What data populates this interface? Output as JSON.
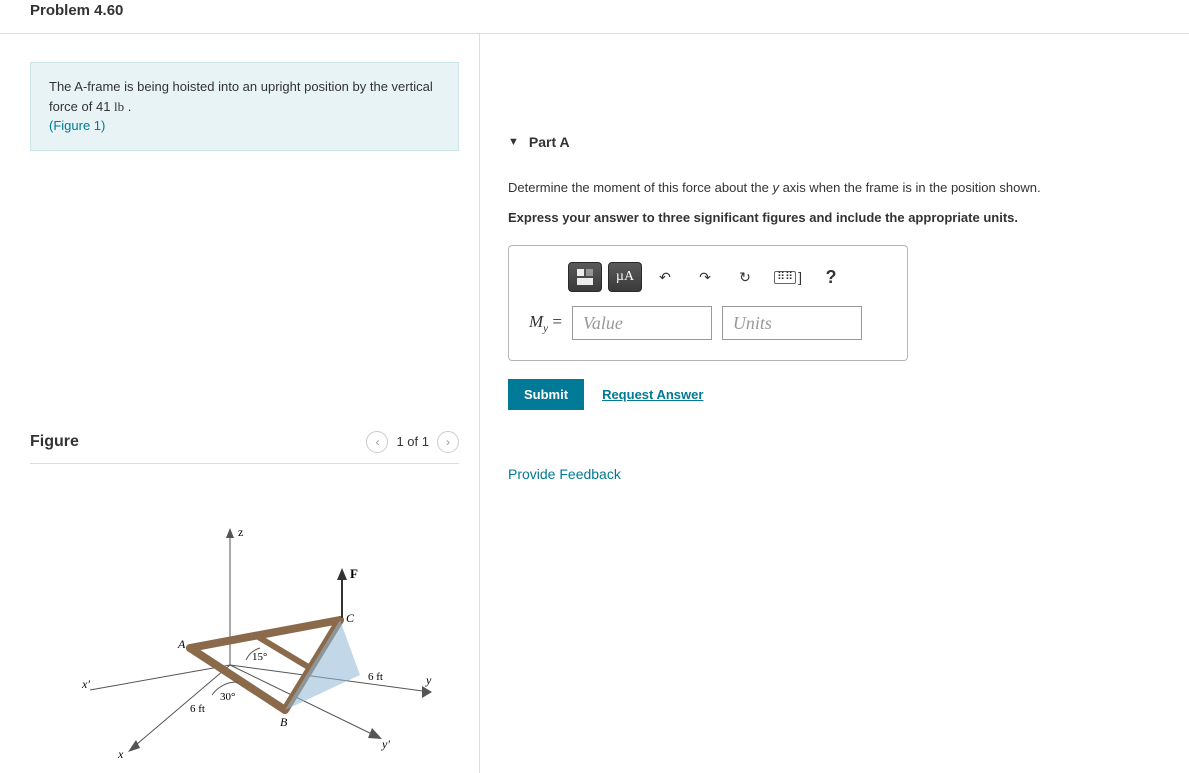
{
  "problem": {
    "title": "Problem 4.60",
    "statement_1": "The A-frame is being hoisted into an upright position by the vertical force of 41 ",
    "statement_unit": "lb",
    "statement_2": " .",
    "figure_link": "(Figure 1)"
  },
  "figure": {
    "title": "Figure",
    "pager": "1 of 1",
    "labels": {
      "z": "z",
      "x": "x",
      "xp": "x′",
      "y": "y",
      "yp": "y′",
      "A": "A",
      "B": "B",
      "C": "C",
      "F": "F",
      "ang15": "15°",
      "ang30": "30°",
      "len1": "6 ft",
      "len2": "6 ft"
    }
  },
  "part": {
    "label": "Part A",
    "question_1": "Determine the moment of this force about the ",
    "question_axis": "y",
    "question_2": " axis when the frame is in the position shown.",
    "instruction": "Express your answer to three significant figures and include the appropriate units.",
    "lhs_sym": "M",
    "lhs_sub": "y",
    "eq": "=",
    "value_placeholder": "Value",
    "units_placeholder": "Units",
    "toolbar": {
      "template": "template-icon",
      "units_btn": "µA",
      "undo": "↶",
      "redo": "↷",
      "reset": "↻",
      "keyboard": "⌨",
      "bracket": "]",
      "help": "?"
    },
    "submit": "Submit",
    "request_answer": "Request Answer"
  },
  "feedback": "Provide Feedback"
}
